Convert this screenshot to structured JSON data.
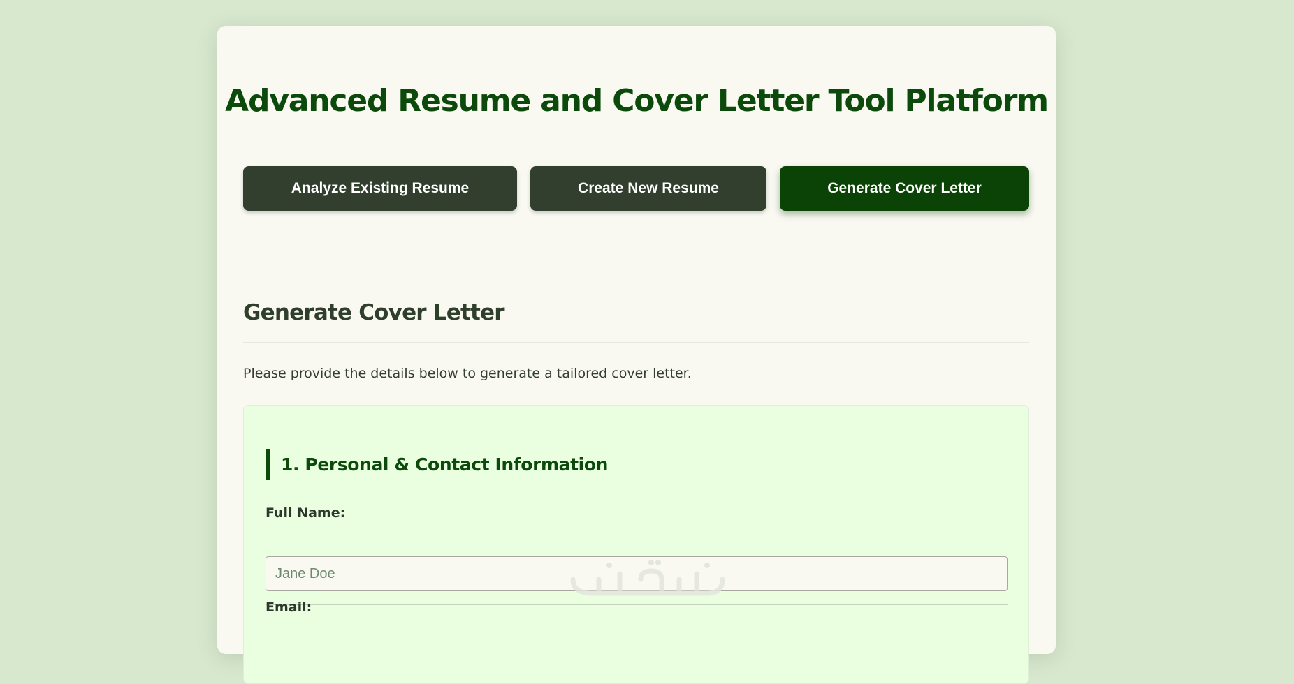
{
  "header": {
    "title": "Advanced Resume and Cover Letter Tool Platform"
  },
  "nav": {
    "buttons": [
      {
        "label": "Analyze Existing Resume",
        "active": false
      },
      {
        "label": "Create New Resume",
        "active": false
      },
      {
        "label": "Generate Cover Letter",
        "active": true
      }
    ]
  },
  "section": {
    "title": "Generate Cover Letter",
    "intro": "Please provide the details below to generate a tailored cover letter."
  },
  "form": {
    "personal": {
      "title": "1. Personal & Contact Information",
      "full_name_label": "Full Name:",
      "full_name_placeholder": "Jane Doe",
      "full_name_value": "",
      "email_label": "Email:"
    }
  },
  "watermark": {
    "text": "خمسات"
  },
  "colors": {
    "page_bg": "#d8e8cf",
    "card_bg": "#f9f9f2",
    "accent": "#0b4a0b",
    "button_bg": "#323f2e",
    "active_button_bg": "#0a4305",
    "panel_bg": "#eaffdf"
  }
}
